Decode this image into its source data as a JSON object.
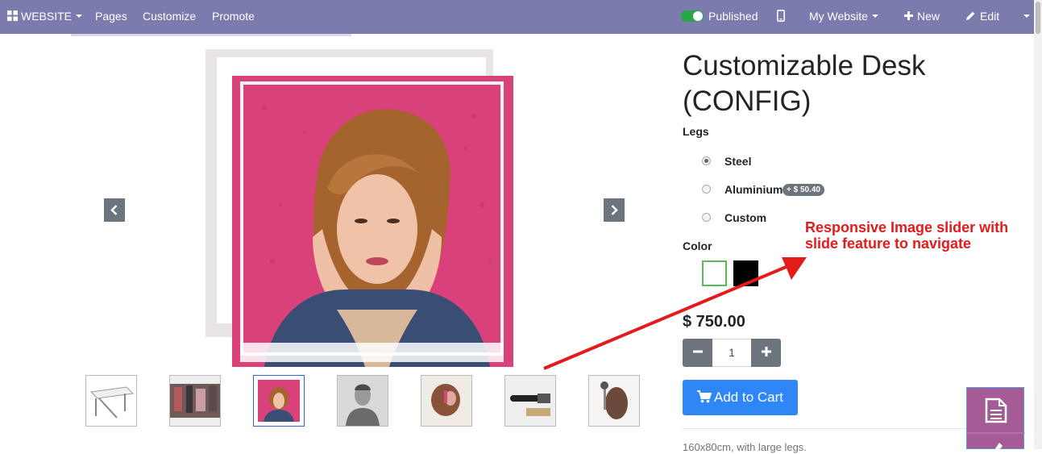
{
  "navbar": {
    "website_label": "WEBSITE",
    "pages_label": "Pages",
    "customize_label": "Customize",
    "promote_label": "Promote",
    "published_label": "Published",
    "my_website_label": "My Website",
    "new_label": "New",
    "edit_label": "Edit",
    "bg_color": "#7c7bad"
  },
  "gallery": {
    "prev_icon": "chevron-left-icon",
    "next_icon": "chevron-right-icon",
    "thumbnails": [
      {
        "name": "thumb-desk"
      },
      {
        "name": "thumb-street"
      },
      {
        "name": "thumb-woman-pink",
        "active": true
      },
      {
        "name": "thumb-man-portrait"
      },
      {
        "name": "thumb-hair"
      },
      {
        "name": "thumb-tools"
      },
      {
        "name": "thumb-woman-hair"
      }
    ]
  },
  "product": {
    "title": "Customizable Desk (CONFIG)",
    "legs_label": "Legs",
    "legs_options": [
      {
        "label": "Steel",
        "checked": true
      },
      {
        "label": "Aluminium",
        "extra": "+ $ 50.40"
      },
      {
        "label": "Custom"
      }
    ],
    "color_label": "Color",
    "colors": [
      "#ffffff",
      "#000000"
    ],
    "price": "$ 750.00",
    "quantity": "1",
    "add_to_cart_label": "Add to Cart",
    "description": "160x80cm, with large legs."
  },
  "annotation": {
    "line1": "Responsive Image slider with",
    "line2": "slide feature to navigate",
    "color": "#e31b1b"
  }
}
